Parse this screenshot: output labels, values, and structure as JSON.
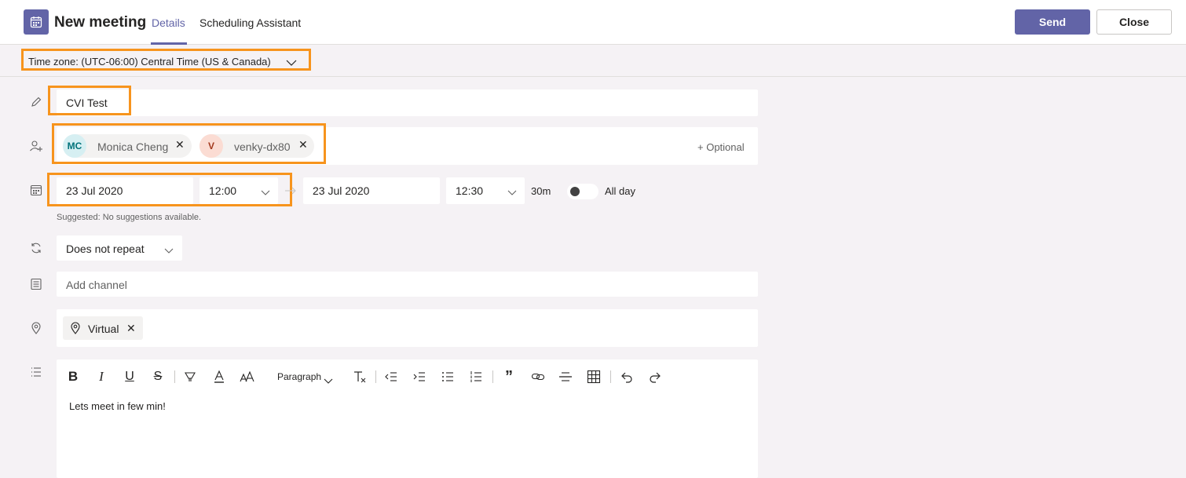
{
  "header": {
    "title": "New meeting",
    "tabs": [
      {
        "label": "Details"
      },
      {
        "label": "Scheduling Assistant"
      }
    ],
    "send_label": "Send",
    "close_label": "Close"
  },
  "timezone": {
    "label": "Time zone: (UTC-06:00) Central Time (US & Canada)"
  },
  "form": {
    "title_value": "CVI Test",
    "attendees": [
      {
        "initials": "MC",
        "name": "Monica Cheng"
      },
      {
        "initials": "V",
        "name": "venky-dx80"
      }
    ],
    "optional_label": "+ Optional",
    "start_date": "23 Jul 2020",
    "start_time": "12:00",
    "end_date": "23 Jul 2020",
    "end_time": "12:30",
    "duration": "30m",
    "all_day_label": "All day",
    "suggestion_text": "Suggested: No suggestions available.",
    "repeat_value": "Does not repeat",
    "channel_placeholder": "Add channel",
    "location_value": "Virtual",
    "editor": {
      "paragraph_label": "Paragraph",
      "body_text": "Lets meet in few min!"
    }
  },
  "colors": {
    "accent": "#6264a7",
    "highlight": "#f7941d"
  }
}
